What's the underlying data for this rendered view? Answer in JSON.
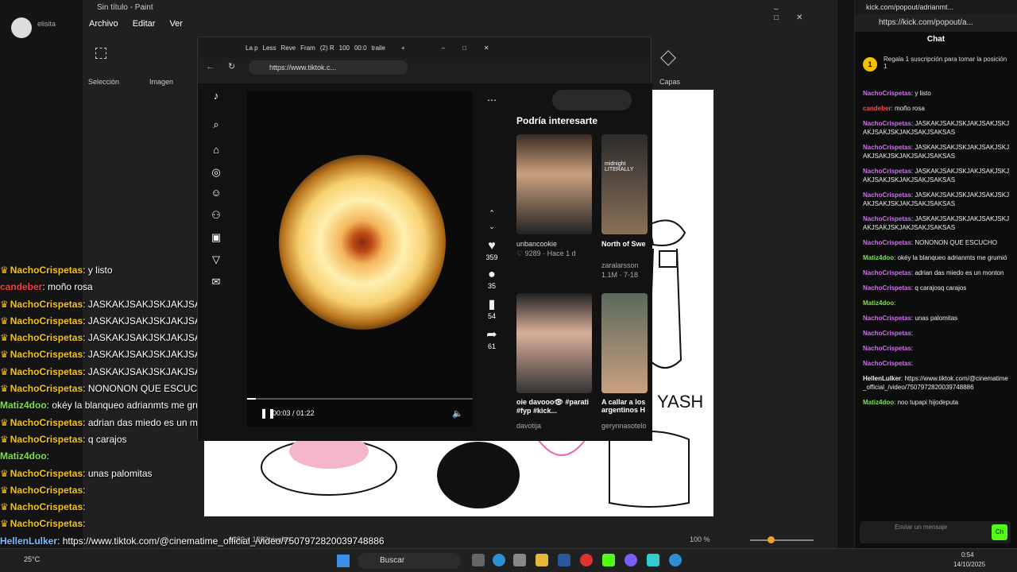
{
  "paint": {
    "title": "Sin título - Paint",
    "menu": [
      "Archivo",
      "Editar",
      "Ver"
    ],
    "groups": {
      "selection": "Selección",
      "image": "Imagen",
      "layers": "Capas"
    },
    "status": {
      "size": "1282 x 1282píxeles",
      "zoom": "100 %"
    },
    "username": "elisita"
  },
  "browser": {
    "tabs": [
      "La p",
      "Less",
      "Reve",
      "Fram",
      "(2) R",
      "100",
      "00:0",
      "traile"
    ],
    "url": "https://www.tiktok.c..."
  },
  "tiktok": {
    "video": {
      "time": "00:03 / 01:22",
      "progress": 0.04
    },
    "actions": {
      "likes": "359",
      "comments": "35",
      "saves": "54",
      "shares": "61"
    },
    "suggest_title": "Podría interesarte",
    "suggestions": [
      {
        "user": "unbancookie",
        "meta": "♡ 9289 · Hace 1 d",
        "caption": ""
      },
      {
        "user": "zaralarsson",
        "meta": "1.1M · 7-18",
        "caption": "North of Swe"
      },
      {
        "user": "davotija",
        "meta": "",
        "caption": "oie davooo👁 #parati #fyp #kick..."
      },
      {
        "user": "gerynnasotelo",
        "meta": "",
        "caption": "A callar a los argentinos H"
      }
    ],
    "thumb_text": "midnight LITERALLY"
  },
  "overlay_chat": [
    {
      "user": "NachoCrispetas",
      "msg": "y listo",
      "color": "#f5c518",
      "crown": true
    },
    {
      "user": "candeber",
      "msg": "moño rosa",
      "color": "#ff3b3b",
      "crown": false
    },
    {
      "user": "NachoCrispetas",
      "msg": "JASKAKJSAKJSKJAKJSAKJSKJAKJSAKJSKJAKJSAKSAS",
      "color": "#f5c518",
      "crown": true
    },
    {
      "user": "NachoCrispetas",
      "msg": "JASKAKJSAKJSKJAKJSAKJSKJAKJSAKJSKJAKJSAKSAS",
      "color": "#f5c518",
      "crown": true
    },
    {
      "user": "NachoCrispetas",
      "msg": "JASKAKJSAKJSKJAKJSAKJSKJAKJSAKJSKJAKJSAKSAS",
      "color": "#f5c518",
      "crown": true
    },
    {
      "user": "NachoCrispetas",
      "msg": "JASKAKJSAKJSKJAKJSAKJSKJAKJSAKJSKJAKJSAKSAS",
      "color": "#f5c518",
      "crown": true
    },
    {
      "user": "NachoCrispetas",
      "msg": "JASKAKJSAKJSKJAKJSAKJSKJAKJSAKJSKJAKJSAKSAS",
      "color": "#f5c518",
      "crown": true
    },
    {
      "user": "NachoCrispetas",
      "msg": "NONONON QUE ESCUCHO",
      "color": "#f5c518",
      "crown": true
    },
    {
      "user": "Matiz4doo",
      "msg": "okéy la blanqueo adrianmts me grumió",
      "color": "#7fe04a",
      "crown": false
    },
    {
      "user": "NachoCrispetas",
      "msg": "adrian das miedo es un monton",
      "color": "#f5c518",
      "crown": true
    },
    {
      "user": "NachoCrispetas",
      "msg": "q carajos",
      "color": "#f5c518",
      "crown": true
    },
    {
      "user": "Matiz4doo",
      "msg": "",
      "color": "#7fe04a",
      "crown": false
    },
    {
      "user": "NachoCrispetas",
      "msg": "unas palomitas",
      "color": "#f5c518",
      "crown": true
    },
    {
      "user": "NachoCrispetas",
      "msg": "",
      "color": "#f5c518",
      "crown": true
    },
    {
      "user": "NachoCrispetas",
      "msg": "",
      "color": "#f5c518",
      "crown": true
    },
    {
      "user": "NachoCrispetas",
      "msg": "",
      "color": "#f5c518",
      "crown": true
    },
    {
      "user": "HellenLulker",
      "msg": "https://www.tiktok.com/@cinematime_official_/video/7507972820039748886",
      "color": "#7cc0ff",
      "crown": false
    },
    {
      "user": "Matiz4doo",
      "msg": "noo tupapi hijodeputa",
      "color": "#7fe04a",
      "crown": false
    }
  ],
  "kick": {
    "window_title": "kick.com/popout/adrianmt...",
    "url": "https://kick.com/popout/a...",
    "header": "Chat",
    "sub_badge": "1",
    "sub_text": "Regala 1 suscripción para tomar la posición 1",
    "messages": [
      {
        "user": "NachoCrispetas",
        "msg": "y listo",
        "color": "#d36ef0"
      },
      {
        "user": "candeber",
        "msg": "moño rosa",
        "color": "#ff4a4a"
      },
      {
        "user": "NachoCrispetas",
        "msg": "JASKAKJSAKJSKJAKJSAKJSKJAKJSAKJSKJAKJSAKJSAKSAS",
        "color": "#d36ef0"
      },
      {
        "user": "NachoCrispetas",
        "msg": "JASKAKJSAKJSKJAKJSAKJSKJAKJSAKJSKJAKJSAKJSAKSAS",
        "color": "#d36ef0"
      },
      {
        "user": "NachoCrispetas",
        "msg": "JASKAKJSAKJSKJAKJSAKJSKJAKJSAKJSKJAKJSAKJSAKSAS",
        "color": "#d36ef0"
      },
      {
        "user": "NachoCrispetas",
        "msg": "JASKAKJSAKJSKJAKJSAKJSKJAKJSAKJSKJAKJSAKJSAKSAS",
        "color": "#d36ef0"
      },
      {
        "user": "NachoCrispetas",
        "msg": "JASKAKJSAKJSKJAKJSAKJSKJAKJSAKJSKJAKJSAKJSAKSAS",
        "color": "#d36ef0"
      },
      {
        "user": "NachoCrispetas",
        "msg": "NONONON QUE ESCUCHO",
        "color": "#d36ef0"
      },
      {
        "user": "Matiz4doo",
        "msg": "okéy la blanqueo adrianmts me grumió",
        "color": "#7fe04a"
      },
      {
        "user": "NachoCrispetas",
        "msg": "adrian das miedo es un monton",
        "color": "#d36ef0"
      },
      {
        "user": "NachoCrispetas",
        "msg": "q carajosq carajos",
        "color": "#d36ef0"
      },
      {
        "user": "Matiz4doo",
        "msg": "",
        "color": "#7fe04a"
      },
      {
        "user": "NachoCrispetas",
        "msg": "unas palomitas",
        "color": "#d36ef0"
      },
      {
        "user": "NachoCrispetas",
        "msg": "",
        "color": "#d36ef0"
      },
      {
        "user": "NachoCrispetas",
        "msg": "",
        "color": "#d36ef0"
      },
      {
        "user": "NachoCrispetas",
        "msg": "",
        "color": "#d36ef0"
      },
      {
        "user": "HellenLulker",
        "msg": "https://www.tiktok.com/@cinematime_official_/video/7507972820039748886",
        "color": "#eee"
      },
      {
        "user": "Matiz4doo",
        "msg": "noo tupapi hijodeputa",
        "color": "#7fe04a"
      }
    ],
    "input_placeholder": "Enviar un mensaje",
    "send_label": "Ch"
  },
  "taskbar": {
    "search": "Buscar",
    "time": "0:54",
    "date": "14/10/2025",
    "temp": "25°C"
  }
}
